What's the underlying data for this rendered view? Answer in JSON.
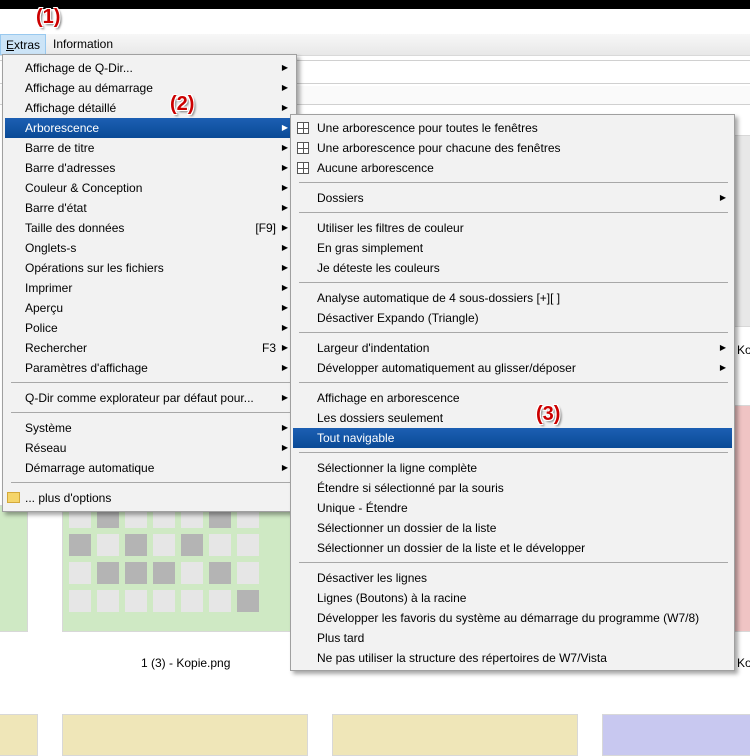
{
  "annotations": [
    "(1)",
    "(2)",
    "(3)"
  ],
  "menubar": {
    "extras_first": "E",
    "extras_rest": "xtras",
    "information": "Information"
  },
  "captions": {
    "thumb_left": "1 (3) - Kopie.png",
    "ko1": "Ko",
    "ko2": "Ko"
  },
  "menu1": {
    "items": [
      {
        "label": "Affichage de Q-Dir...",
        "sub": true
      },
      {
        "label": "Affichage au démarrage",
        "sub": true
      },
      {
        "label": "Affichage détaillé",
        "sub": true
      },
      {
        "label": "Arborescence",
        "sub": true,
        "hl": true
      },
      {
        "label": "Barre de titre",
        "sub": true
      },
      {
        "label": "Barre d'adresses",
        "sub": true
      },
      {
        "label": "Couleur & Conception",
        "sub": true
      },
      {
        "label": "Barre d'état",
        "sub": true
      },
      {
        "label": "Taille des données",
        "shortcut": "[F9]",
        "sub": true
      },
      {
        "label": "Onglets-s",
        "sub": true
      },
      {
        "label": "Opérations sur les fichiers",
        "sub": true
      },
      {
        "label": "Imprimer",
        "sub": true
      },
      {
        "label": "Aperçu",
        "sub": true
      },
      {
        "label": "Police",
        "sub": true
      },
      {
        "label": "Rechercher",
        "shortcut": "F3",
        "sub": true
      },
      {
        "label": "Paramètres d'affichage",
        "sub": true
      },
      {
        "sep": true
      },
      {
        "label": "Q-Dir comme explorateur par défaut pour...",
        "sub": true
      },
      {
        "sep": true
      },
      {
        "label": "Système",
        "sub": true
      },
      {
        "label": "Réseau",
        "sub": true
      },
      {
        "label": "Démarrage automatique",
        "sub": true
      },
      {
        "sep": true
      },
      {
        "label": "... plus d'options",
        "folder": true
      }
    ]
  },
  "menu2": {
    "items": [
      {
        "label": "Une arborescence pour toutes le fenêtres",
        "icon": "grid"
      },
      {
        "label": "Une arborescence pour chacune des fenêtres",
        "icon": "grid"
      },
      {
        "label": "Aucune arborescence",
        "icon": "grid"
      },
      {
        "sep": true
      },
      {
        "label": "Dossiers",
        "sub": true
      },
      {
        "sep": true
      },
      {
        "label": "Utiliser les filtres de couleur"
      },
      {
        "label": "En gras simplement"
      },
      {
        "label": "Je déteste les couleurs"
      },
      {
        "sep": true
      },
      {
        "label": "Analyse automatique de 4 sous-dossiers [+][ ]"
      },
      {
        "label": "Désactiver Expando (Triangle)"
      },
      {
        "sep": true
      },
      {
        "label": "Largeur d'indentation",
        "sub": true
      },
      {
        "label": "Développer automatiquement au glisser/déposer",
        "sub": true
      },
      {
        "sep": true
      },
      {
        "label": "Affichage en arborescence"
      },
      {
        "label": "Les dossiers seulement"
      },
      {
        "label": "Tout navigable",
        "hl": true
      },
      {
        "sep": true
      },
      {
        "label": "Sélectionner la ligne complète"
      },
      {
        "label": "Étendre si sélectionné par la souris"
      },
      {
        "label": "Unique - Étendre"
      },
      {
        "label": "Sélectionner un dossier de la liste"
      },
      {
        "label": "Sélectionner un dossier de la liste et le développer"
      },
      {
        "sep": true
      },
      {
        "label": "Désactiver les lignes"
      },
      {
        "label": "Lignes (Boutons) à la racine"
      },
      {
        "label": "Développer les favoris du système au démarrage du programme (W7/8)"
      },
      {
        "label": "Plus tard"
      },
      {
        "label": "Ne pas utiliser la structure des répertoires de W7/Vista"
      }
    ]
  }
}
